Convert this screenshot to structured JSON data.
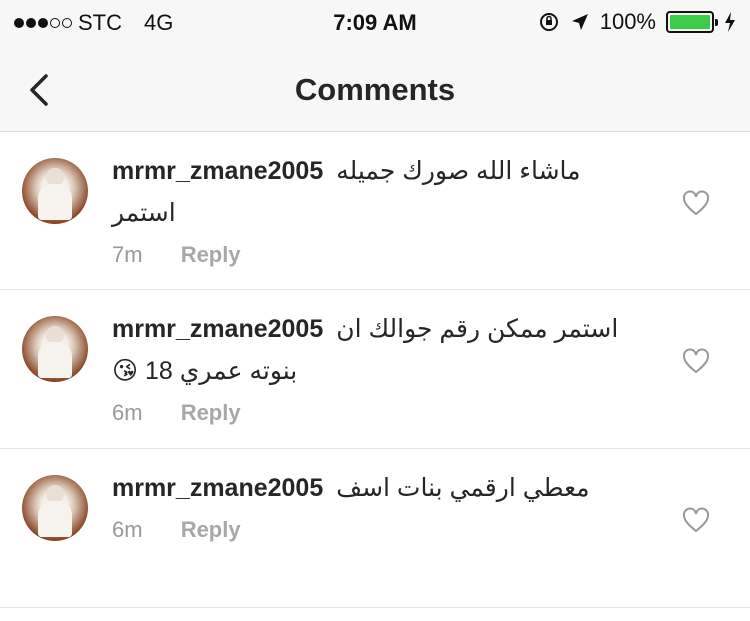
{
  "status_bar": {
    "carrier": "STC",
    "network": "4G",
    "time": "7:09 AM",
    "battery": "100%",
    "battery_level": 1.0
  },
  "nav": {
    "title": "Comments",
    "back_icon": "chevron-left-icon"
  },
  "comments": [
    {
      "username": "mrmr_zmane2005",
      "text": "ماشاء الله  صورك جميله",
      "text_line2": "استمر",
      "time": "7m",
      "reply_label": "Reply"
    },
    {
      "username": "mrmr_zmane2005",
      "text": "استمر  ممكن رقم جوالك  ان",
      "text_line2": "بنوته عمري 18 😘",
      "time": "6m",
      "reply_label": "Reply"
    },
    {
      "username": "mrmr_zmane2005",
      "text": "معطي  ارقمي بنات اسف",
      "text_line2": "",
      "time": "6m",
      "reply_label": "Reply"
    }
  ],
  "colors": {
    "battery_fill": "#3ccd4a",
    "meta_text": "#999999"
  }
}
